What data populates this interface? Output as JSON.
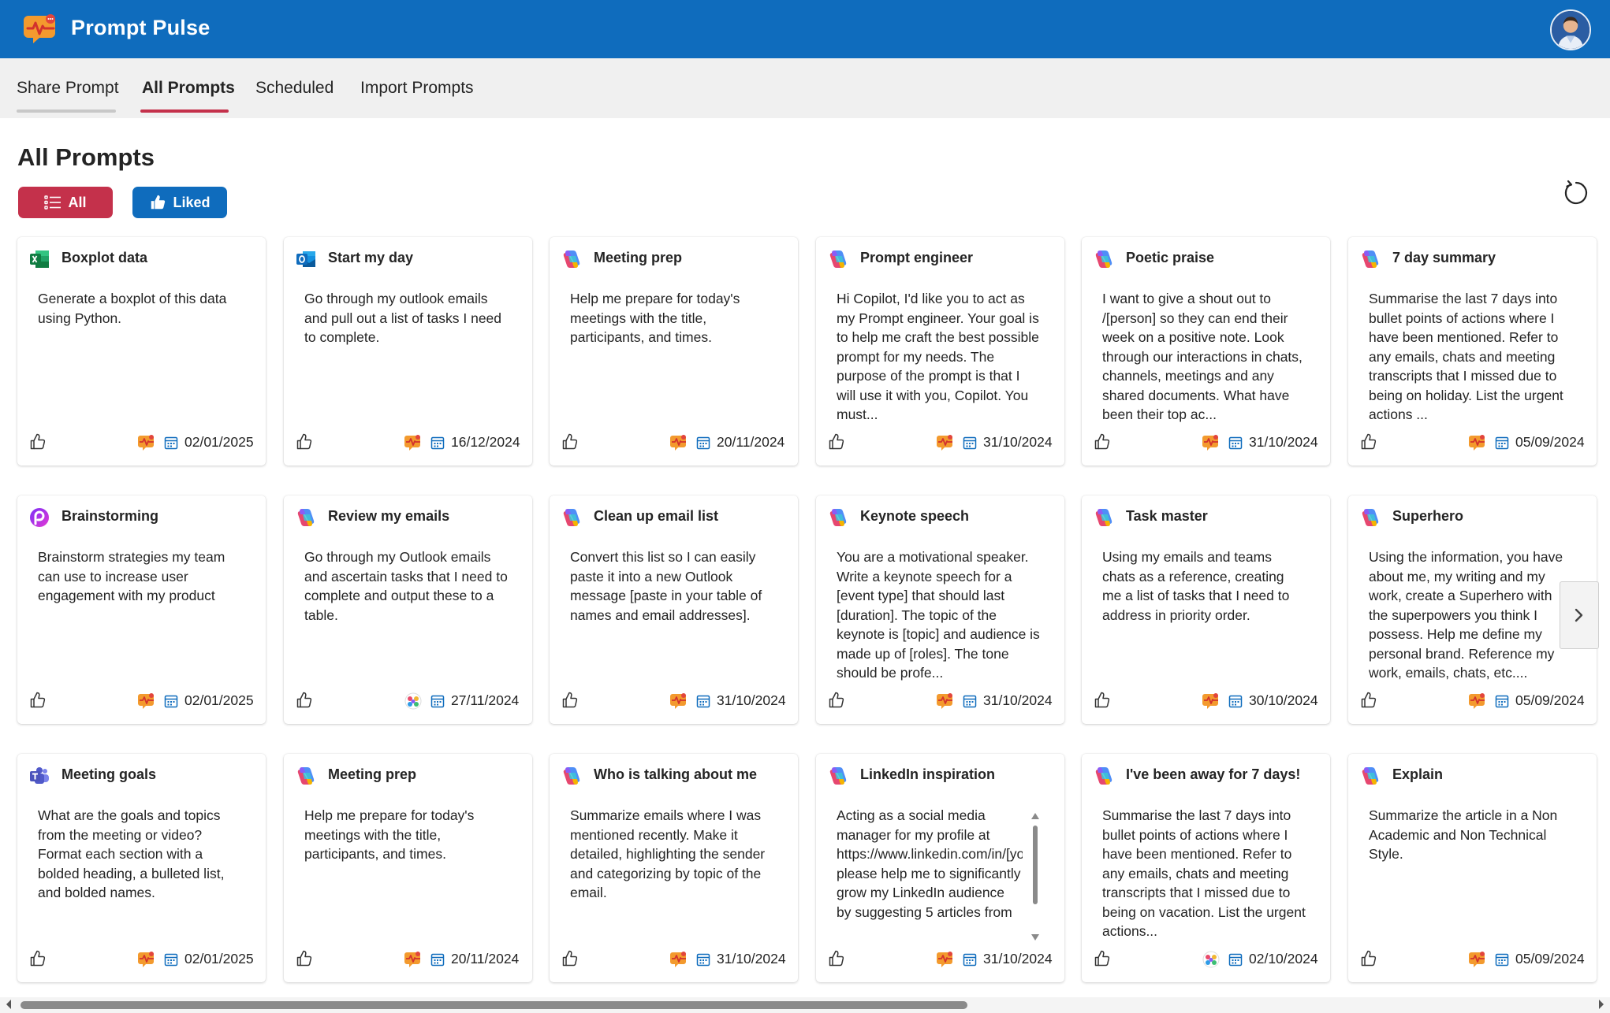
{
  "app": {
    "title": "Prompt Pulse"
  },
  "tabs": [
    {
      "label": "Share Prompt"
    },
    {
      "label": "All Prompts",
      "active": true
    },
    {
      "label": "Scheduled"
    },
    {
      "label": "Import Prompts"
    }
  ],
  "page": {
    "title": "All Prompts"
  },
  "filters": {
    "all_label": "All",
    "liked_label": "Liked"
  },
  "colors": {
    "header": "#0f6cbd",
    "accent": "#c4314b",
    "liked": "#0f6cbd"
  },
  "cards": [
    {
      "title": "Boxplot data",
      "icon": "excel-icon",
      "body": "Generate a boxplot of this data using Python.",
      "date": "02/01/2025"
    },
    {
      "title": "Start my day",
      "icon": "outlook-icon",
      "body": "Go through my outlook emails and pull out a list of tasks I need to complete.",
      "date": "16/12/2024"
    },
    {
      "title": "Meeting prep",
      "icon": "copilot-icon",
      "body": "Help me prepare for today's meetings with the title, participants, and times.",
      "date": "20/11/2024"
    },
    {
      "title": "Prompt engineer",
      "icon": "copilot-icon",
      "body": "Hi Copilot, I'd like you to act as my Prompt engineer. Your goal is to help me craft the best possible prompt for my needs. The purpose of the prompt is that I will use it with you, Copilot. You must...",
      "date": "31/10/2024"
    },
    {
      "title": "Poetic praise",
      "icon": "copilot-icon",
      "body": "I want to give a shout out to /[person] so they can end their week on a positive note. Look through our interactions in chats, channels, meetings and any shared documents. What have been their top ac...",
      "date": "31/10/2024"
    },
    {
      "title": "7 day summary",
      "icon": "copilot-icon",
      "body": "Summarise the last 7 days into bullet points of actions where I have been mentioned. Refer to any emails, chats and meeting transcripts that I missed due to being on holiday. List the urgent actions ...",
      "date": "05/09/2024"
    },
    {
      "title": "Brainstorming",
      "icon": "loop-icon",
      "body": "Brainstorm strategies my team can use to increase user engagement with my product",
      "date": "02/01/2025"
    },
    {
      "title": "Review my emails",
      "icon": "copilot-icon",
      "body": "Go through my Outlook emails and ascertain tasks that I need to complete and output these to a table.",
      "date": "27/11/2024"
    },
    {
      "title": "Clean up email list",
      "icon": "copilot-icon",
      "body": "Convert this list so I can easily paste it into a new Outlook message [paste in your table of names and email addresses].",
      "date": "31/10/2024"
    },
    {
      "title": "Keynote speech",
      "icon": "copilot-icon",
      "body": "You are a motivational speaker. Write a keynote speech for a [event type] that should last [duration]. The topic of the keynote is [topic] and audience is made up of [roles]. The tone should be profe...",
      "date": "31/10/2024"
    },
    {
      "title": "Task master",
      "icon": "copilot-icon",
      "body": "Using my emails and teams chats as a reference, creating me a list of tasks that I need to address in priority order.",
      "date": "30/10/2024"
    },
    {
      "title": "Superhero",
      "icon": "copilot-icon",
      "body": "Using the information, you have about me, my writing and my work, create a Superhero with the superpowers you think I possess. Help me define my personal brand. Reference my work, emails, chats, etc....",
      "date": "05/09/2024"
    },
    {
      "title": "Meeting goals",
      "icon": "teams-icon",
      "body": "What are the goals and topics from the meeting or video? Format each section with a bolded heading, a bulleted list, and bolded names.",
      "date": "02/01/2025"
    },
    {
      "title": "Meeting prep",
      "icon": "copilot-icon",
      "body": "Help me prepare for today's meetings with the title, participants, and times.",
      "date": "20/11/2024"
    },
    {
      "title": "Who is talking about me",
      "icon": "copilot-icon",
      "body": "Summarize emails where I was mentioned recently. Make it detailed, highlighting the sender and categorizing by topic of the email.",
      "date": "31/10/2024"
    },
    {
      "title": "LinkedIn inspiration",
      "icon": "copilot-icon",
      "body": "Acting as a social media manager for my profile at https://www.linkedin.com/in/[yourusername], please help me to significantly grow my LinkedIn audience by suggesting 5 articles from",
      "date": "31/10/2024"
    },
    {
      "title": "I've been away for 7 days!",
      "icon": "copilot-icon",
      "body": "Summarise the last 7 days into bullet points of actions where I have been mentioned. Refer to any emails, chats and meeting transcripts that I missed due to being on vacation. List the urgent actions...",
      "date": "02/10/2024"
    },
    {
      "title": "Explain",
      "icon": "copilot-icon",
      "body": "Summarize the article in a Non Academic and Non Technical Style.",
      "date": "05/09/2024"
    }
  ]
}
